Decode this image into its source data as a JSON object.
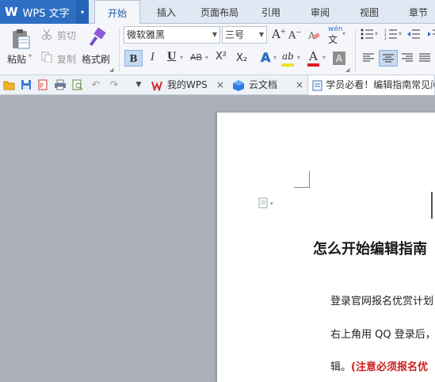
{
  "app": {
    "logo_letter": "W",
    "logo_text": "WPS 文字",
    "logo_dropdown": "▾"
  },
  "menu_tabs": [
    "开始",
    "插入",
    "页面布局",
    "引用",
    "审阅",
    "视图",
    "章节"
  ],
  "ribbon": {
    "paste_label": "粘贴",
    "cut_label": "剪切",
    "copy_label": "复制",
    "format_painter_label": "格式刷",
    "font_name": "微软雅黑",
    "font_size": "三号",
    "grow_font": "A⁺",
    "shrink_font": "A⁻",
    "phonetic_label": "wén",
    "bold": "B",
    "italic": "I",
    "underline": "U",
    "strikethrough": "AB",
    "superscript": "X²",
    "subscript": "X₂",
    "text_effect": "A",
    "highlight": "ab",
    "font_color": "A",
    "char_shading": "A"
  },
  "doc_tabs": {
    "my_wps": "我的WPS",
    "cloud_docs": "云文档",
    "active_doc": "学员必看！编辑指南常见问"
  },
  "document": {
    "heading": "怎么开始编辑指南",
    "line1": "登录官网报名优赏计划",
    "line2": "右上角用 QQ 登录后，",
    "line3_prefix": "辑。",
    "line3_red": "(注意必须报名优"
  },
  "colors": {
    "brand": "#2e6fc4",
    "accent_red": "#cc1f1f",
    "font_color_bar": "#d92020",
    "highlight_bar": "#f5e21a"
  }
}
